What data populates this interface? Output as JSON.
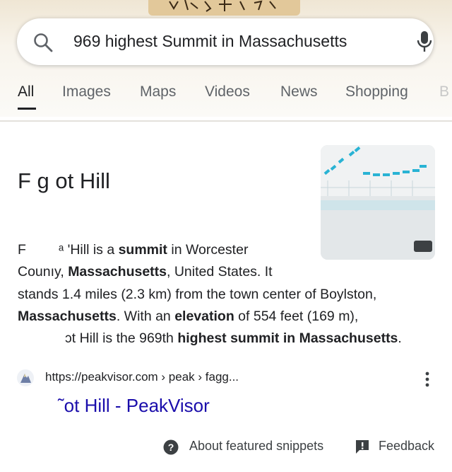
{
  "search": {
    "query": "969 highest Summit in Massachusetts"
  },
  "tabs": [
    {
      "label": "All",
      "active": true
    },
    {
      "label": "Images"
    },
    {
      "label": "Maps"
    },
    {
      "label": "Videos"
    },
    {
      "label": "News"
    },
    {
      "label": "Shopping"
    },
    {
      "label": "B"
    }
  ],
  "featured": {
    "title": "F   g   ot Hill",
    "snippet_lines": {
      "l1_a": "F",
      "l1_b": "ᵃ 'Hill is a ",
      "l1_bold": "summit",
      "l1_c": " in Worcester",
      "l2_a": "Counıy, ",
      "l2_bold": "Massachusetts",
      "l2_c": ", United States. It",
      "l3": "stands 1.4 miles (2.3 km) from the town center of Boylston,",
      "l4_bold": "Massachusetts",
      "l4_a": ". With an ",
      "l4_bold2": "elevation",
      "l4_b": " of 554 feet (169 m),",
      "l5_a": "ɔt Hill is the 969th ",
      "l5_bold": "highest summit in Massachusetts",
      "l5_b": "."
    }
  },
  "source": {
    "url": "https://peakvisor.com › peak › fagg...",
    "link_title": "˜ot Hill - PeakVisor"
  },
  "footer": {
    "about": "About featured snippets",
    "feedback": "Feedback"
  },
  "colors": {
    "link": "#1a0dab",
    "text": "#202124",
    "muted": "#5f6368"
  }
}
